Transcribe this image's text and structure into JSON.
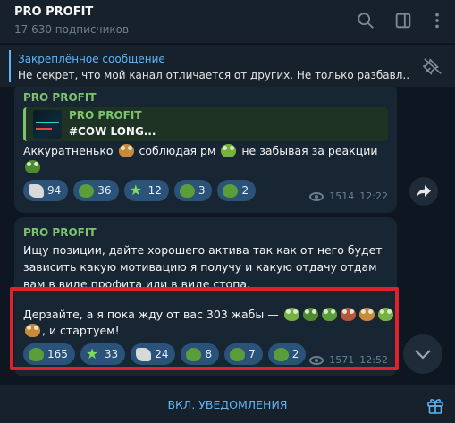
{
  "header": {
    "title": "PRO PROFIT",
    "subtitle": "17 630 подписчиков",
    "icons": [
      "search-icon",
      "sidebar-toggle-icon",
      "more-icon"
    ]
  },
  "pinned": {
    "label": "Закреплённое сообщение",
    "text": "Не секрет, что мой канал отличается от других.  Не только разбавл...",
    "icon": "unpin-icon"
  },
  "messages": [
    {
      "sender": "PRO PROFIT",
      "reply": {
        "name": "PRO PROFIT",
        "text": "#COW LONG..."
      },
      "text_line1_a": "Аккуратненько",
      "text_line1_b": "соблюдая рм",
      "text_line1_c": "не забывая за реакции",
      "reactions": [
        {
          "icon": "plane-icon",
          "count": "94"
        },
        {
          "icon": "frog-icon",
          "count": "36"
        },
        {
          "icon": "star-icon",
          "count": "12"
        },
        {
          "icon": "frog-icon",
          "count": "3"
        },
        {
          "icon": "frog-icon",
          "count": "2"
        }
      ],
      "views": "1514",
      "time": "12:22"
    },
    {
      "sender": "PRO PROFIT",
      "lines": [
        "Ищу позиции, дайте хорошего актива так как от него будет",
        "зависить какую мотивацию я получу и какую отдачу отдам",
        "вам в виде профита или в виде стопа."
      ],
      "line4": "Дерзайте, а я пока жду от вас 303 жабы —",
      "line5": ", и стартуем!",
      "reactions": [
        {
          "icon": "frog-icon",
          "count": "165"
        },
        {
          "icon": "star-icon",
          "count": "33"
        },
        {
          "icon": "plane-icon",
          "count": "24"
        },
        {
          "icon": "heart-frog-icon",
          "count": "8"
        },
        {
          "icon": "frog-icon",
          "count": "7"
        },
        {
          "icon": "frog-icon",
          "count": "2"
        }
      ],
      "views": "1571",
      "time": "12:52"
    }
  ],
  "footer": {
    "button": "ВКЛ. УВЕДОМЛЕНИЯ",
    "icon": "gift-icon"
  },
  "colors": {
    "background": "#0e1621",
    "header": "#17212b",
    "bubble": "#182533",
    "accent": "#5eb5f7",
    "sender": "#7ec36e",
    "reaction": "#2b5278",
    "highlight": "#e0222e"
  }
}
